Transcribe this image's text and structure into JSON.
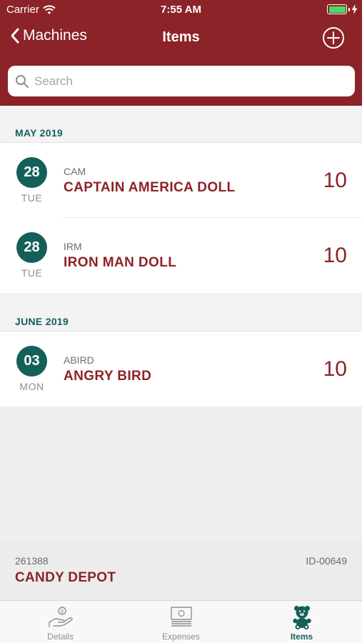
{
  "status_bar": {
    "carrier": "Carrier",
    "time": "7:55 AM",
    "wifi_icon": "wifi-icon",
    "battery_icon": "battery-icon"
  },
  "nav": {
    "back_label": "Machines",
    "title": "Items",
    "add_icon": "plus-circle-icon"
  },
  "search": {
    "placeholder": "Search",
    "value": "",
    "icon": "search-icon"
  },
  "sections": [
    {
      "title": "MAY 2019",
      "items": [
        {
          "day": "28",
          "weekday": "TUE",
          "code": "CAM",
          "name": "CAPTAIN AMERICA DOLL",
          "qty": "10"
        },
        {
          "day": "28",
          "weekday": "TUE",
          "code": "IRM",
          "name": "IRON MAN DOLL",
          "qty": "10"
        }
      ]
    },
    {
      "title": "JUNE 2019",
      "items": [
        {
          "day": "03",
          "weekday": "MON",
          "code": "ABIRD",
          "name": "ANGRY BIRD",
          "qty": "10"
        }
      ]
    }
  ],
  "location": {
    "code": "261388",
    "name": "CANDY DEPOT",
    "machine_id": "ID-00649"
  },
  "tabs": [
    {
      "label": "Details",
      "icon": "hand-coin-icon",
      "active": false
    },
    {
      "label": "Expenses",
      "icon": "cash-stack-icon",
      "active": false
    },
    {
      "label": "Items",
      "icon": "teddy-bear-icon",
      "active": true
    }
  ],
  "colors": {
    "primary": "#8c2328",
    "accent": "#155f5b",
    "background": "#efefef"
  }
}
